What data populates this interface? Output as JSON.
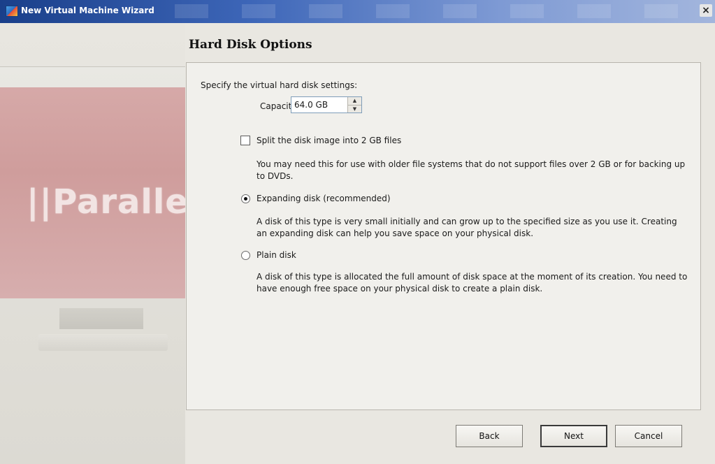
{
  "window": {
    "title": "New Virtual Machine Wizard",
    "close_glyph": "×"
  },
  "sidebar": {
    "brand_text": "||Parallels"
  },
  "page": {
    "heading": "Hard Disk Options"
  },
  "panel": {
    "intro": "Specify the virtual hard disk settings:",
    "capacity": {
      "label": "Capacity:",
      "value": "64.0 GB",
      "up_glyph": "▲",
      "down_glyph": "▼"
    },
    "split_option": {
      "label": "Split the disk image into 2 GB files",
      "checked": false,
      "description": "You may need this for use with older file systems that do not support files over 2 GB or for backing up to DVDs."
    },
    "expanding_option": {
      "label": "Expanding disk (recommended)",
      "selected": true,
      "description": "A disk of this type is very small initially and can grow up to the specified size as you use it. Creating an expanding disk can help you save space on your physical disk."
    },
    "plain_option": {
      "label": "Plain disk",
      "selected": false,
      "description": "A disk of this type is allocated the full amount of disk space at the moment of its creation. You need to have enough free space on your physical disk to create a plain disk."
    }
  },
  "buttons": {
    "back": "Back",
    "next": "Next",
    "cancel": "Cancel"
  }
}
